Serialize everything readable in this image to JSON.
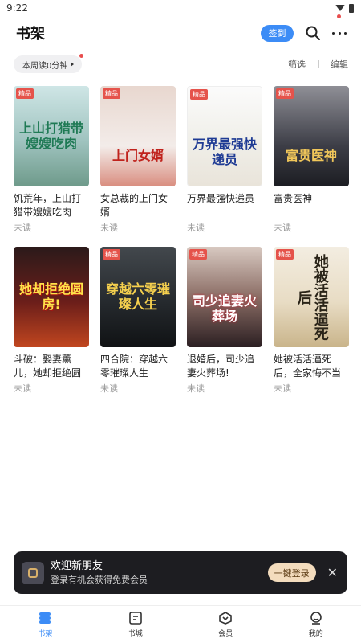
{
  "status": {
    "time": "9:22"
  },
  "header": {
    "title": "书架",
    "checkin_label": "签到"
  },
  "subbar": {
    "reading_time": "本周读0分钟",
    "filter_label": "筛选",
    "edit_label": "编辑"
  },
  "books": [
    {
      "title": "饥荒年，上山打猎带嫂嫂吃肉",
      "status": "未读",
      "badge": "精品",
      "cover_text": "上山打猎带嫂嫂吃肉"
    },
    {
      "title": "女总裁的上门女婿",
      "status": "未读",
      "badge": "精品",
      "cover_text": "上门女婿"
    },
    {
      "title": "万界最强快递员",
      "status": "未读",
      "badge": "精品",
      "cover_text": "万界最强快递员"
    },
    {
      "title": "富贵医神",
      "status": "未读",
      "badge": "精品",
      "cover_text": "富贵医神"
    },
    {
      "title": "斗破：娶妻薰儿，她却拒绝圆房!",
      "status": "未读",
      "badge": "",
      "cover_text": "她却拒绝圆房!"
    },
    {
      "title": "四合院：穿越六零璀璨人生",
      "status": "未读",
      "badge": "精品",
      "cover_text": "穿越六零璀璨人生"
    },
    {
      "title": "退婚后，司少追妻火葬场!",
      "status": "未读",
      "badge": "精品",
      "cover_text": "司少追妻火葬场"
    },
    {
      "title": "她被活活逼死后，全家悔不当初",
      "status": "未读",
      "badge": "精品",
      "cover_text": "她被活活逼死后"
    }
  ],
  "promo": {
    "title": "欢迎新朋友",
    "subtitle": "登录有机会获得免费会员",
    "login_label": "一键登录"
  },
  "tabs": [
    {
      "label": "书架",
      "icon": "bookshelf-icon",
      "active": true
    },
    {
      "label": "书城",
      "icon": "bookstore-icon",
      "active": false
    },
    {
      "label": "会员",
      "icon": "vip-icon",
      "active": false
    },
    {
      "label": "我的",
      "icon": "profile-icon",
      "active": false
    }
  ],
  "colors": {
    "accent": "#3c8cf6",
    "badge": "#e5534b",
    "promo_bg": "#1d1d21"
  }
}
